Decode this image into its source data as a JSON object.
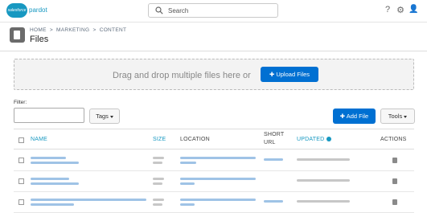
{
  "topbar": {
    "logo_text": "salesforce",
    "product": "pardot",
    "search_placeholder": "Search",
    "help_glyph": "?",
    "settings_glyph": "⚙",
    "user_glyph": "👤"
  },
  "breadcrumb": [
    "HOME",
    ">",
    "MARKETING",
    ">",
    "CONTENT"
  ],
  "page_title": "Files",
  "dropzone": {
    "message": "Drag and drop multiple files here or",
    "upload_label": "Upload Files"
  },
  "filter": {
    "label": "Filter:",
    "value": "",
    "tags_label": "Tags"
  },
  "actions": {
    "add_file_label": "Add File",
    "tools_label": "Tools"
  },
  "table": {
    "headers": {
      "name": "NAME",
      "size": "SIZE",
      "location": "LOCATION",
      "short_url_1": "SHORT",
      "short_url_2": "URL",
      "updated": "UPDATED",
      "actions": "ACTIONS"
    },
    "rows": [
      {
        "name": "",
        "size": "",
        "location": "",
        "short_url": "",
        "updated": ""
      },
      {
        "name": "",
        "size": "",
        "location": "",
        "short_url": "",
        "updated": ""
      },
      {
        "name": "",
        "size": "",
        "location": "",
        "short_url": "",
        "updated": ""
      }
    ]
  },
  "colors": {
    "brand": "#1798c1",
    "button_blue": "#0070d2"
  },
  "icons": [
    "search-icon",
    "help-icon",
    "settings-icon",
    "user-icon",
    "content-icon",
    "plus-icon",
    "info-icon",
    "caret-down-icon"
  ]
}
